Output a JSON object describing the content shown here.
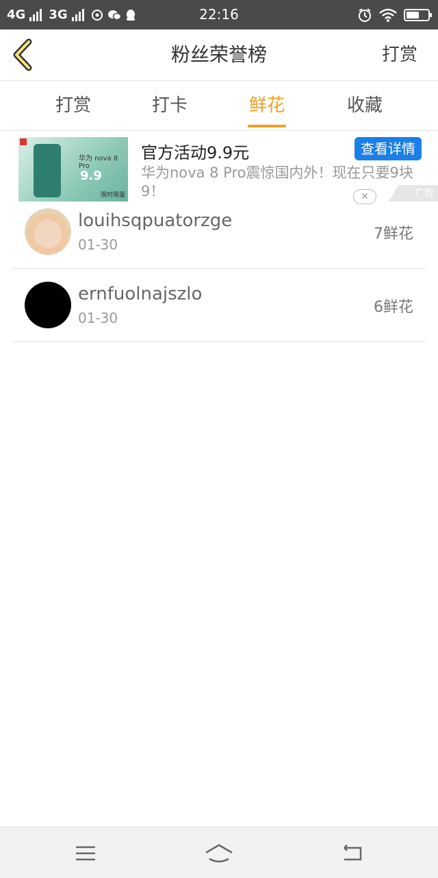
{
  "status_bar": {
    "network1": "4G",
    "network2": "3G",
    "time": "22:16",
    "battery_level": 0.6,
    "icons": [
      "signal-icon",
      "netease-icon",
      "wechat-icon",
      "qq-icon",
      "alarm-icon",
      "wifi-icon",
      "battery-icon"
    ]
  },
  "header": {
    "title": "粉丝荣誉榜",
    "action": "打赏",
    "back_icon": "chevron-left-icon"
  },
  "tabs": [
    {
      "label": "打赏",
      "active": false
    },
    {
      "label": "打卡",
      "active": false
    },
    {
      "label": "鲜花",
      "active": true
    },
    {
      "label": "收藏",
      "active": false
    }
  ],
  "colors": {
    "accent": "#f0a020",
    "ad_button": "#1a7fe6",
    "status_bar": "#4a4a4a"
  },
  "ad": {
    "title": "官方活动9.9元",
    "button": "查看详情",
    "description": "华为nova 8  Pro震惊国内外！现在只要9块9！",
    "image_brand": "华为 nova 8 Pro",
    "image_price": "9.9",
    "image_limit": "限时限量",
    "tag": "广告"
  },
  "list": [
    {
      "name": "louihsqpuatorzge",
      "date": "01-30",
      "count": "7鲜花"
    },
    {
      "name": "ernfuolnajszlo",
      "date": "01-30",
      "count": "6鲜花"
    }
  ],
  "navbar": {
    "icons": [
      "menu-icon",
      "home-icon",
      "back-icon"
    ]
  }
}
